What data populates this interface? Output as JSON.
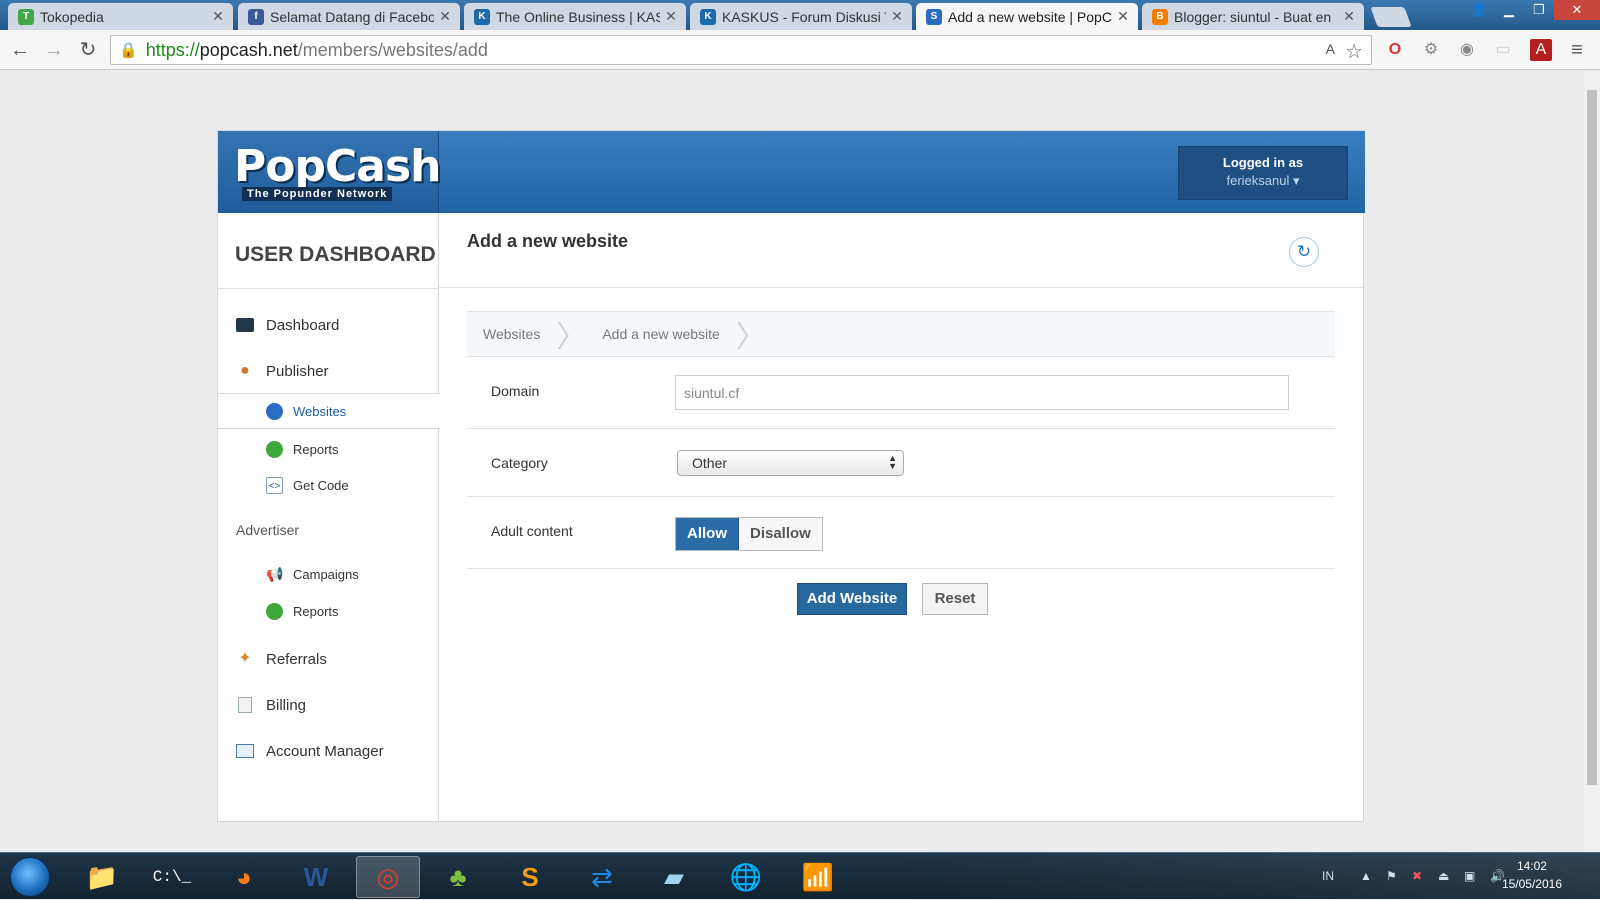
{
  "browser": {
    "tabs": [
      {
        "title": "Tokopedia",
        "favicon_color": "#41a845",
        "favicon_glyph": "T",
        "active": false
      },
      {
        "title": "Selamat Datang di Facebo",
        "favicon_color": "#3b5998",
        "favicon_glyph": "f",
        "active": false
      },
      {
        "title": "The Online Business | KAS",
        "favicon_color": "#1d6aa8",
        "favicon_glyph": "K",
        "active": false
      },
      {
        "title": "KASKUS - Forum Diskusi T",
        "favicon_color": "#1d6aa8",
        "favicon_glyph": "K",
        "active": false
      },
      {
        "title": "Add a new website | PopC",
        "favicon_color": "#2a6fbf",
        "favicon_glyph": "S",
        "active": true
      },
      {
        "title": "Blogger: siuntul - Buat en",
        "favicon_color": "#f57d00",
        "favicon_glyph": "B",
        "active": false
      }
    ],
    "close_glyph": "✕",
    "url": {
      "scheme": "https://",
      "host": "popcash.net",
      "path": "/members/websites/add"
    },
    "icons": {
      "back": "←",
      "forward": "→",
      "reload": "↻",
      "lock": "🔒",
      "star": "☆",
      "translate": "A",
      "menu": "≡"
    }
  },
  "header": {
    "logo_main": "PopCash",
    "logo_tagline": "The Popunder Network",
    "logged_in_label": "Logged in as",
    "username": "ferieksanul ▾"
  },
  "sidebar": {
    "title": "USER DASHBOARD",
    "dashboard": "Dashboard",
    "publisher": "Publisher",
    "publisher_items": [
      "Websites",
      "Reports",
      "Get Code"
    ],
    "advertiser": "Advertiser",
    "advertiser_items": [
      "Campaigns",
      "Reports"
    ],
    "referrals": "Referrals",
    "billing": "Billing",
    "account_manager": "Account Manager"
  },
  "content": {
    "title": "Add a new website",
    "refresh_icon": "↻",
    "breadcrumb": [
      "Websites",
      "Add a new website"
    ],
    "domain_label": "Domain",
    "domain_value": "siuntul.cf",
    "category_label": "Category",
    "category_value": "Other",
    "adult_label": "Adult content",
    "adult_options": [
      "Allow",
      "Disallow"
    ],
    "add_button": "Add Website",
    "reset_button": "Reset"
  },
  "taskbar": {
    "lang": "IN",
    "time": "14:02",
    "date": "15/05/2016"
  },
  "colors": {
    "brand_blue": "#2064a4",
    "primary_button": "#27689f",
    "chrome_frame": "#2c5e8c"
  }
}
